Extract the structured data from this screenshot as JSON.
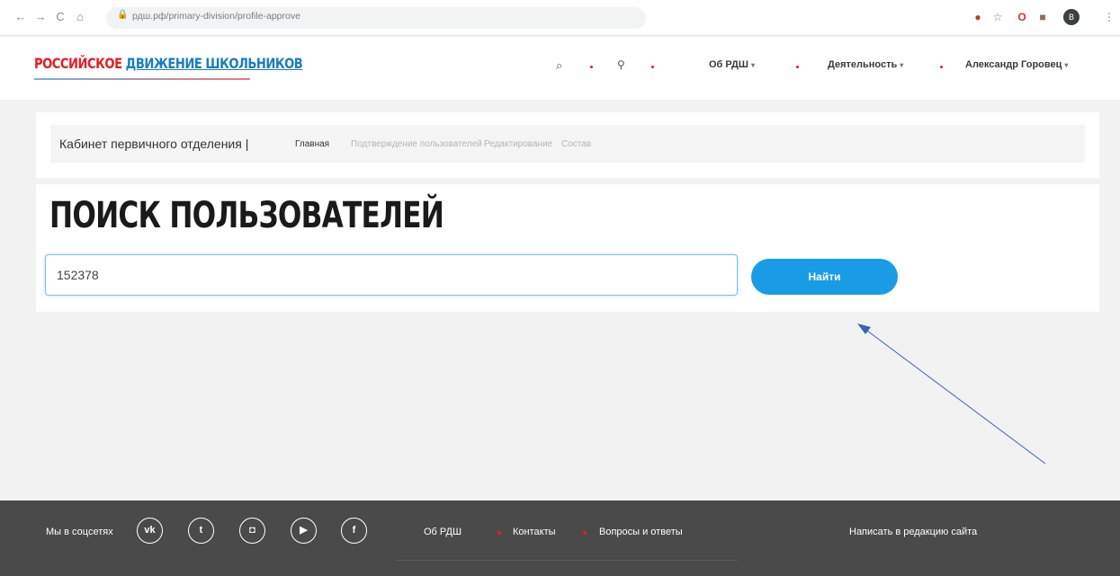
{
  "browser": {
    "back": "←",
    "forward": "→",
    "reload": "C",
    "home": "⌂",
    "lock": "🔒",
    "url": "рдш.рф/primary-division/profile-approve",
    "avatar_letter": "В"
  },
  "header": {
    "logo_red": "РОССИЙСКОЕ",
    "logo_blue": "ДВИЖЕНИЕ ШКОЛЬНИКОВ",
    "nav": {
      "about": "Об РДШ",
      "activity": "Деятельность",
      "user": "Александр Горовец"
    },
    "caret": "▾"
  },
  "cabinet": {
    "title": "Кабинет первичного отделения |",
    "links": [
      "Главная",
      "Подтверждение пользователей",
      "Редактирование",
      "Состав"
    ]
  },
  "search": {
    "title": "ПОИСК ПОЛЬЗОВАТЕЛЕЙ",
    "value": "152378",
    "button": "Найти"
  },
  "footer": {
    "social_label": "Мы в соцсетях",
    "social_icons": [
      "vk-icon",
      "twitter-icon",
      "instagram-icon",
      "youtube-icon",
      "facebook-icon"
    ],
    "social_glyphs": [
      "vk",
      "t",
      "◘",
      "▶",
      "f"
    ],
    "links": [
      "Об РДШ",
      "Контакты",
      "Вопросы и ответы"
    ],
    "write": "Написать в редакцию сайта"
  },
  "colors": {
    "accent": "#1a9be6",
    "brand_red": "#e31e24",
    "brand_blue": "#1b7dc1",
    "footer_bg": "#4a4a4a"
  }
}
